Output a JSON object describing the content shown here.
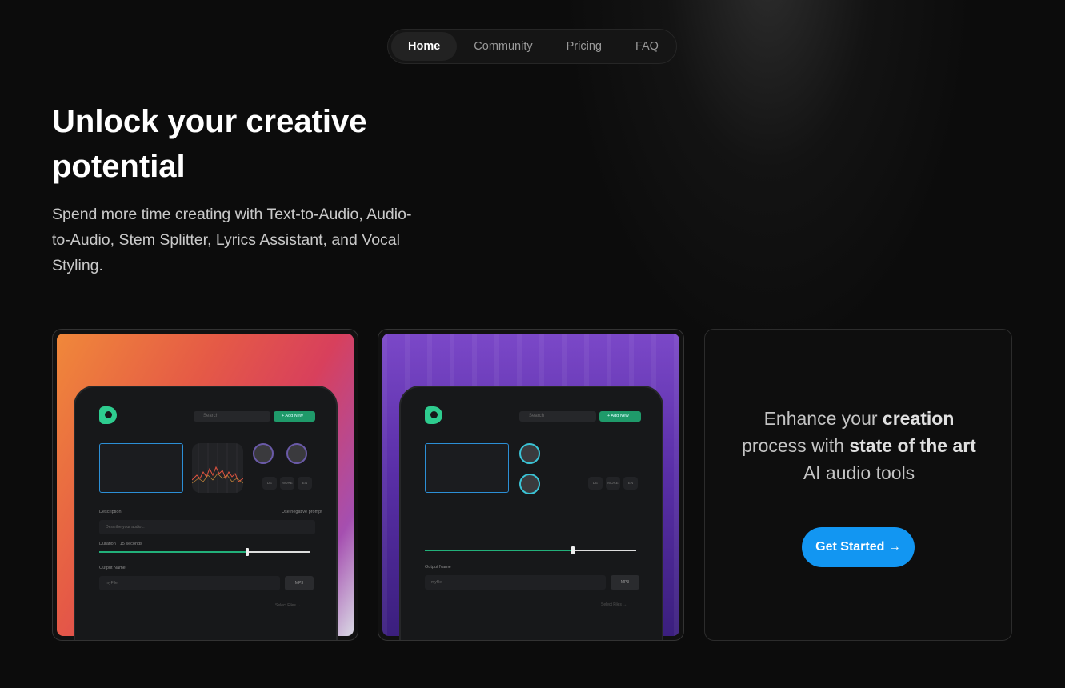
{
  "nav": {
    "items": [
      {
        "label": "Home",
        "active": true
      },
      {
        "label": "Community",
        "active": false
      },
      {
        "label": "Pricing",
        "active": false
      },
      {
        "label": "FAQ",
        "active": false
      }
    ]
  },
  "hero": {
    "title": "Unlock your creative potential",
    "subtitle": "Spend more time creating with Text-to-Audio, Audio-to-Audio, Stem Splitter, Lyrics Assistant, and Vocal Styling."
  },
  "cards": {
    "card1": {
      "search_placeholder": "Search",
      "add_label": "+ Add New",
      "description_label": "Description",
      "negative_prompt_label": "Use negative prompt",
      "description_placeholder": "Describe your audio...",
      "duration_label": "Duration · 15 seconds",
      "output_name_label": "Output Name",
      "output_name_value": "myFile",
      "format": "MP3",
      "knob_buttons": [
        "DE",
        "MORE",
        "EN"
      ],
      "select_link": "Select Files →",
      "slider_fraction": 0.7
    },
    "card2": {
      "search_placeholder": "Search",
      "add_label": "+ Add New",
      "output_name_label": "Output Name",
      "output_name_value": "myfile",
      "format": "MP3",
      "knob_buttons": [
        "DE",
        "MORE",
        "EN"
      ],
      "select_link": "Select Files →",
      "slider_fraction": 0.7
    },
    "card3": {
      "text_1": "Enhance your ",
      "text_bold_1": "creation",
      "text_2": " process with ",
      "text_bold_2": "state of the art",
      "text_3": " AI audio tools",
      "cta_label": "Get Started →"
    }
  },
  "colors": {
    "background": "#0c0c0c",
    "accent_blue": "#1296f2",
    "accent_green": "#2ecc8f"
  }
}
